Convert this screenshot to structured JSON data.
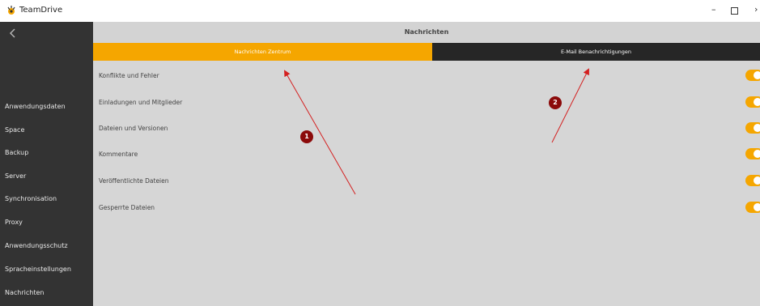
{
  "window": {
    "title": "TeamDrive",
    "controls": {
      "minimize": "–",
      "close": "›"
    }
  },
  "sidebar": {
    "items": [
      {
        "label": "Anwendungsdaten"
      },
      {
        "label": "Space"
      },
      {
        "label": "Backup"
      },
      {
        "label": "Server"
      },
      {
        "label": "Synchronisation"
      },
      {
        "label": "Proxy"
      },
      {
        "label": "Anwendungsschutz"
      },
      {
        "label": "Spracheinstellungen"
      },
      {
        "label": "Nachrichten"
      }
    ]
  },
  "main": {
    "title": "Nachrichten",
    "tabs": [
      {
        "label": "Nachrichten Zentrum",
        "active": true
      },
      {
        "label": "E-Mail Benachrichtigungen",
        "active": false
      }
    ],
    "settings": [
      {
        "label": "Konflikte und Fehler",
        "enabled": true
      },
      {
        "label": "Einladungen und Mitglieder",
        "enabled": true
      },
      {
        "label": "Dateien und Versionen",
        "enabled": true
      },
      {
        "label": "Kommentare",
        "enabled": true
      },
      {
        "label": "Veröffentlichte Dateien",
        "enabled": true
      },
      {
        "label": "Gesperrte Dateien",
        "enabled": true
      }
    ]
  },
  "annotations": {
    "badges": [
      "1",
      "2"
    ]
  },
  "colors": {
    "accent": "#f5a600",
    "sidebar_bg": "#333333",
    "content_bg": "#d6d6d6",
    "tab_inactive_bg": "#262626",
    "annotation": "#d42020",
    "badge": "#8b0a0a"
  }
}
